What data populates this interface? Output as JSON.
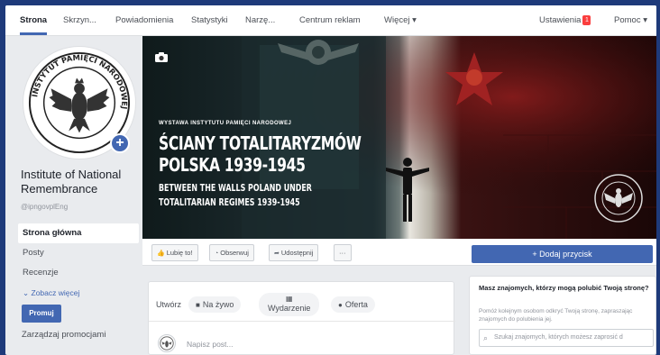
{
  "topnav": {
    "tabs": [
      "Strona",
      "Skrzyn...",
      "Powiadomienia",
      "Statystyki",
      "Narzę...",
      "Centrum reklam",
      "Więcej ▾"
    ],
    "settings": "Ustawienia",
    "settings_badge": "1",
    "help": "Pomoc ▾"
  },
  "avatar": {
    "seal_text": "INSTYTUT PAMIĘCI NARODOWEJ",
    "add_icon": "plus-icon"
  },
  "page": {
    "name": "Institute of National Remembrance",
    "handle": "@ipngovplEng"
  },
  "left_nav": {
    "items": [
      "Strona główna",
      "Posty",
      "Recenzje",
      "Zobacz więcej"
    ]
  },
  "promote": {
    "button": "Promuj",
    "manage": "Zarządzaj promocjami"
  },
  "cover": {
    "camera_icon": "camera-icon",
    "subtitle": "WYSTAWA INSTYTUTU PAMIĘCI NARODOWEJ",
    "title_line1": "ŚCIANY TOTALITARYZMÓW",
    "title_line2": "POLSKA 1939-1945",
    "english_line1": "BETWEEN THE WALLS POLAND UNDER",
    "english_line2": "TOTALITARIAN REGIMES 1939-1945"
  },
  "actions": {
    "like": "Lubię to!",
    "follow": "Obserwuj",
    "share": "Udostępnij",
    "more": "···",
    "add_button": "+ Dodaj przycisk"
  },
  "composer": {
    "create": "Utwórz",
    "live": "Na żywo",
    "event": "Wydarzenie",
    "offer": "Oferta",
    "placeholder": "Napisz post..."
  },
  "invite_card": {
    "title": "Masz znajomych, którzy mogą polubić Twoją stronę?",
    "description": "Pomóż kolejnym osobom odkryć Twoją stronę, zapraszając znajomych do polubienia jej.",
    "search_placeholder": "Szukaj znajomych, których możesz zaprosić d"
  },
  "colors": {
    "accent": "#4267b2",
    "page_bg": "#e9ebee",
    "badge": "#fa3e3e"
  }
}
